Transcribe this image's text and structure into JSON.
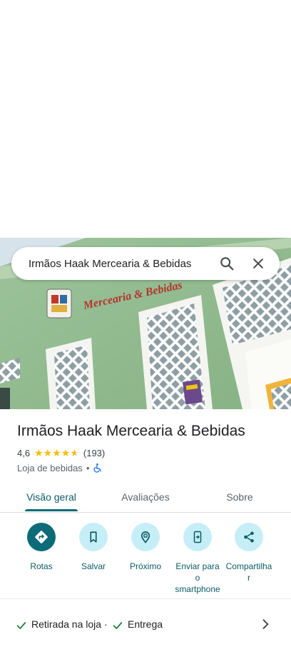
{
  "search": {
    "query": "Irmãos Haak Mercearia & Bebidas"
  },
  "place": {
    "name": "Irmãos Haak Mercearia & Bebidas",
    "rating": "4,6",
    "stars": 4.6,
    "review_count": "(193)",
    "category": "Loja de bebidas",
    "separator": "•",
    "photo_sign_text": "Mercearia & Bebidas"
  },
  "tabs": [
    {
      "label": "Visão geral"
    },
    {
      "label": "Avaliações"
    },
    {
      "label": "Sobre"
    }
  ],
  "actions": [
    {
      "label": "Rotas"
    },
    {
      "label": "Salvar"
    },
    {
      "label": "Próximo"
    },
    {
      "label": "Enviar para\no\nsmartphone"
    },
    {
      "label": "Compartilha\nr"
    }
  ],
  "services": {
    "pickup": "Retirada na loja ·",
    "delivery": "Entrega"
  },
  "colors": {
    "accent": "#0b6b78",
    "accent_light": "#c6eef6",
    "star": "#fbbc04",
    "check": "#188038",
    "accessibility": "#1a73e8"
  }
}
